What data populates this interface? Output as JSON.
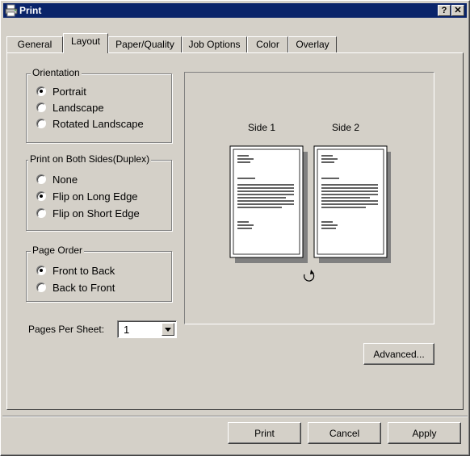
{
  "window": {
    "title": "Print",
    "help_label": "?",
    "close_label": "✕"
  },
  "tabs": [
    {
      "label": "General"
    },
    {
      "label": "Layout"
    },
    {
      "label": "Paper/Quality"
    },
    {
      "label": "Job Options"
    },
    {
      "label": "Color"
    },
    {
      "label": "Overlay"
    }
  ],
  "active_tab": "Layout",
  "orientation": {
    "legend": "Orientation",
    "options": [
      "Portrait",
      "Landscape",
      "Rotated Landscape"
    ],
    "selected": "Portrait"
  },
  "duplex": {
    "legend": "Print on Both Sides(Duplex)",
    "options": [
      "None",
      "Flip on Long Edge",
      "Flip on Short Edge"
    ],
    "selected": "Flip on Long Edge"
  },
  "page_order": {
    "legend": "Page Order",
    "options": [
      "Front to Back",
      "Back to Front"
    ],
    "selected": "Front to Back"
  },
  "pages_per_sheet": {
    "label": "Pages Per Sheet:",
    "value": "1"
  },
  "preview": {
    "side1": "Side 1",
    "side2": "Side 2",
    "flip_icon": "rotate-arrow-icon"
  },
  "buttons": {
    "advanced": "Advanced...",
    "print": "Print",
    "cancel": "Cancel",
    "apply": "Apply"
  }
}
